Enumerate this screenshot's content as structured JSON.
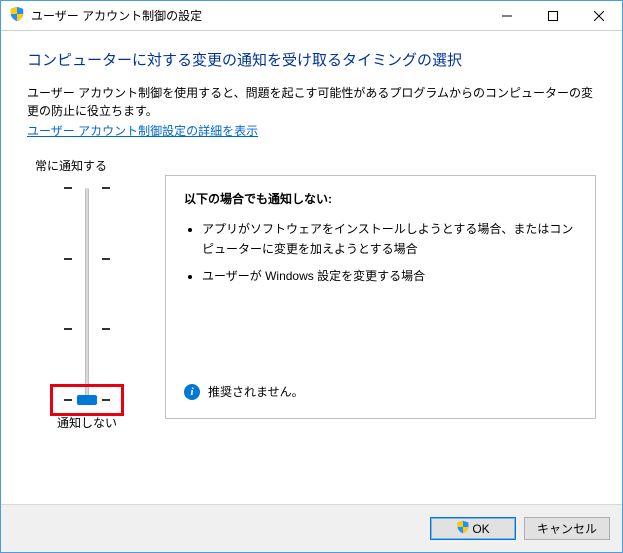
{
  "window": {
    "title": "ユーザー アカウント制御の設定"
  },
  "heading": "コンピューターに対する変更の通知を受け取るタイミングの選択",
  "description": "ユーザー アカウント制御を使用すると、問題を起こす可能性があるプログラムからのコンピューターの変更の防止に役立ちます。",
  "link": "ユーザー アカウント制御設定の詳細を表示",
  "slider": {
    "top_label": "常に通知する",
    "bottom_label": "通知しない",
    "levels": 4,
    "position": 3
  },
  "panel": {
    "title": "以下の場合でも通知しない:",
    "items": [
      "アプリがソフトウェアをインストールしようとする場合、またはコンピューターに変更を加えようとする場合",
      "ユーザーが Windows 設定を変更する場合"
    ],
    "recommend": "推奨されません。"
  },
  "buttons": {
    "ok": "OK",
    "cancel": "キャンセル"
  }
}
